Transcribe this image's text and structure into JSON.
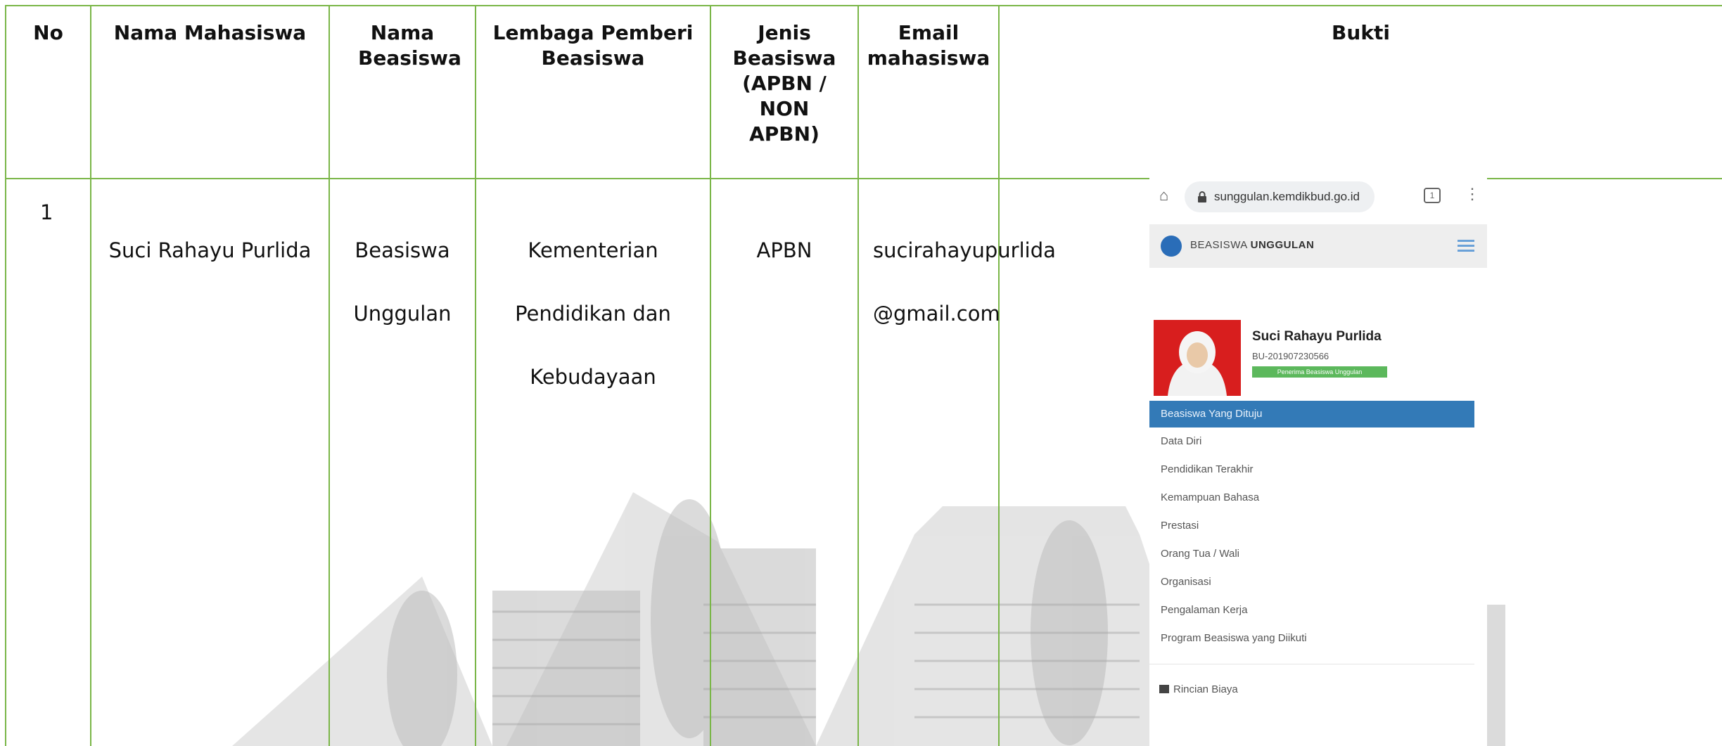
{
  "table": {
    "headers": {
      "no": "No",
      "nama_mahasiswa": "Nama Mahasiswa",
      "nama_beasiswa": "Nama Beasiswa",
      "lembaga": "Lembaga Pemberi Beasiswa",
      "jenis": "Jenis Beasiswa (APBN / NON APBN)",
      "email": "Email mahasiswa",
      "bukti": "Bukti"
    },
    "rows": [
      {
        "no": "1",
        "nama_mahasiswa": "Suci Rahayu Purlida",
        "nama_beasiswa_l1": "Beasiswa",
        "nama_beasiswa_l2": "Unggulan",
        "lembaga_l1": "Kementerian",
        "lembaga_l2": "Pendidikan dan",
        "lembaga_l3": "Kebudayaan",
        "jenis": "APBN",
        "email_l1": "sucirahayupurlida",
        "email_l2": "@gmail.com"
      }
    ]
  },
  "bukti_screenshot": {
    "url": "sunggulan.kemdikbud.go.id",
    "tab_count": "1",
    "app_title_prefix": "BEASISWA ",
    "app_title_bold": "UNGGULAN",
    "profile_name": "Suci Rahayu Purlida",
    "profile_id": "BU-201907230566",
    "status_badge": "Penerima Beasiswa Unggulan",
    "menu": [
      "Beasiswa Yang Dituju",
      "Data Diri",
      "Pendidikan Terakhir",
      "Kemampuan Bahasa",
      "Prestasi",
      "Orang Tua / Wali",
      "Organisasi",
      "Pengalaman Kerja",
      "Program Beasiswa yang Diikuti"
    ],
    "rincian": "Rincian Biaya",
    "colors": {
      "active_menu": "#337ab7",
      "badge": "#5cb85c",
      "border": "#7ab648"
    }
  }
}
